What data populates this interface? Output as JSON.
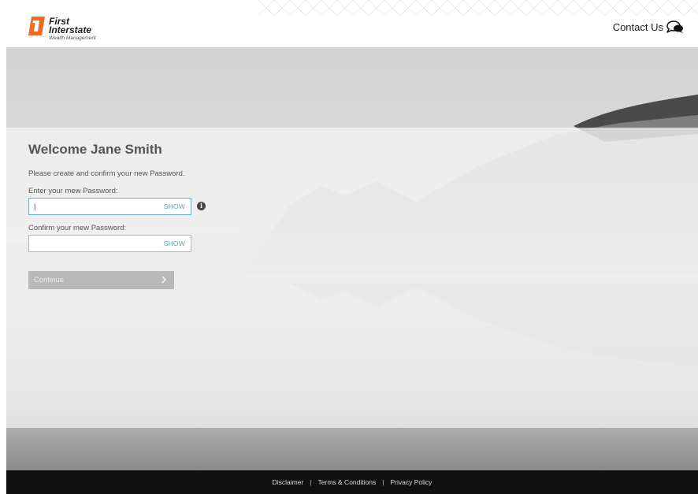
{
  "header": {
    "logo_first": "First",
    "logo_interstate": "Interstate",
    "logo_sub": "Wealth Management",
    "contact_label": "Contact Us"
  },
  "form": {
    "title": "Welcome Jane Smith",
    "intro": "Please create and confirm your new Password.",
    "password_label": "Enter your mew Password:",
    "password_value": "|",
    "password_show": "SHOW",
    "confirm_label": "Confirm your mew Password:",
    "confirm_value": "",
    "confirm_show": "SHOW",
    "info_glyph": "i",
    "continue_label": "Continue",
    "continue_enabled": false
  },
  "footer": {
    "links": [
      "Disclaimer",
      "Terms & Conditions",
      "Privacy Policy"
    ],
    "separator": "|"
  },
  "colors": {
    "brand_orange": "#f26b21",
    "focus_border": "#6db0cc",
    "show_link": "#5a9fc0",
    "footer_bg": "#111111",
    "button_disabled": "#b9b9b9"
  },
  "icons": {
    "contact": "chat-bubbles-icon",
    "info": "info-icon",
    "continue": "chevron-right-icon"
  }
}
